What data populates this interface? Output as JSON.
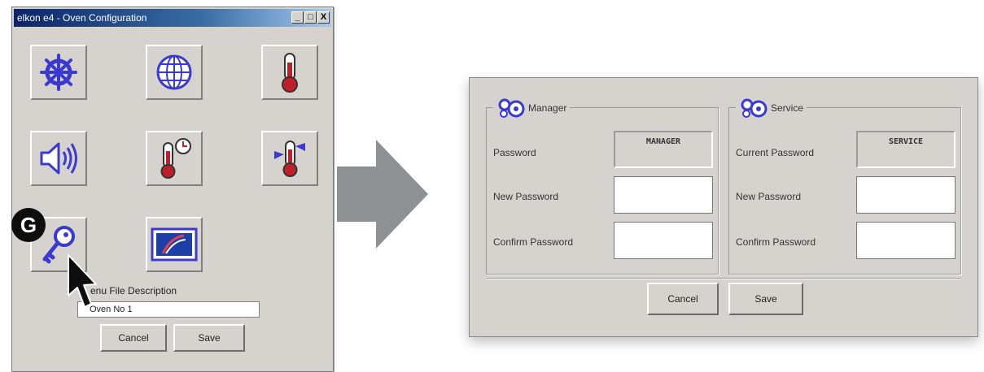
{
  "left_window": {
    "title": "elkon e4 - Oven Configuration",
    "controls": [
      "_",
      "□",
      "X"
    ],
    "icon_buttons": [
      "ship-wheel-icon",
      "globe-icon",
      "thermometer-icon",
      "speaker-icon",
      "thermometer-clock-icon",
      "thermometer-fan-icon",
      "key-icon",
      "logo-screen-icon"
    ],
    "menu_file_label": "enu File Description",
    "menu_file_value": "Oven No 1",
    "cancel_label": "Cancel",
    "save_label": "Save",
    "badge": "G"
  },
  "dialog": {
    "manager": {
      "legend": "Manager",
      "password_label": "Password",
      "password_value": "MANAGER",
      "new_password_label": "New Password",
      "confirm_password_label": "Confirm Password"
    },
    "service": {
      "legend": "Service",
      "password_label": "Current Password",
      "password_value": "SERVICE",
      "new_password_label": "New Password",
      "confirm_password_label": "Confirm Password"
    },
    "cancel_label": "Cancel",
    "save_label": "Save"
  },
  "colors": {
    "window_bg": "#d6d3ce",
    "titlebar": "#0a246a",
    "icon_blue": "#3a3ad0",
    "thermo_red": "#c0202a",
    "arrow_gray": "#8e9193"
  }
}
